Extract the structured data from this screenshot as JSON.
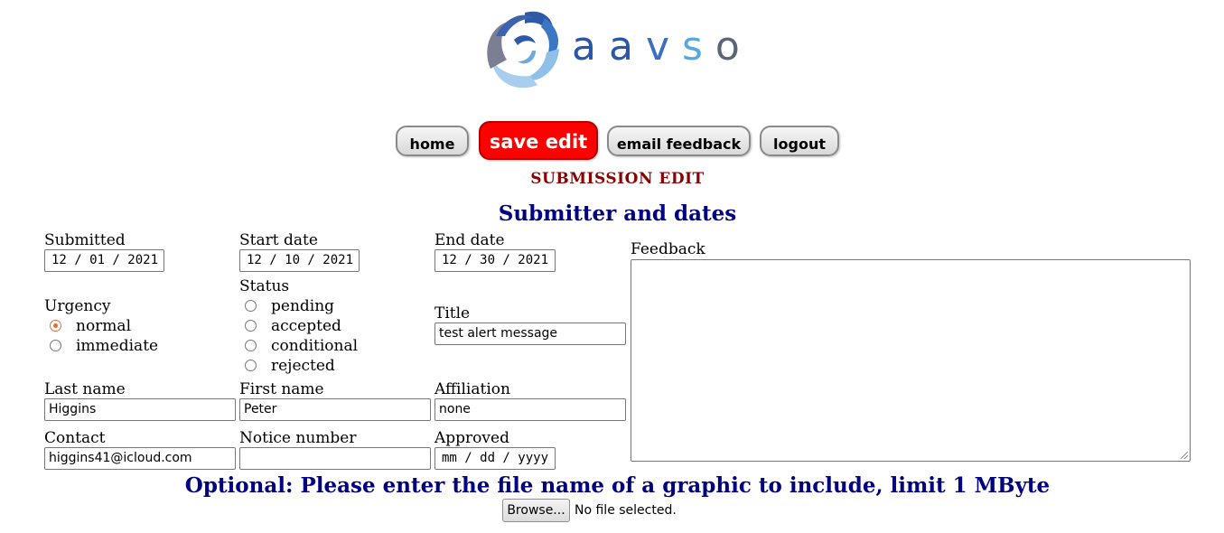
{
  "brand": {
    "name": "aavso",
    "letters": [
      "a",
      "a",
      "v",
      "s",
      "o"
    ],
    "letter_colors": [
      "#2b56a8",
      "#2b56a8",
      "#3a6fc0",
      "#59a7df",
      "#5a6577"
    ],
    "icon": "swirl-logo-icon"
  },
  "nav": {
    "home": "home",
    "save": "save edit",
    "email": "email feedback",
    "logout": "logout"
  },
  "colors": {
    "save_bg": "#ff0000",
    "heading_red": "#8b0000",
    "heading_blue": "#000080",
    "radio_checked": "#e86a3a"
  },
  "page_title": "SUBMISSION EDIT",
  "section_title": "Submitter and dates",
  "fields": {
    "submitted": {
      "label": "Submitted",
      "value": "12 / 01 / 2021"
    },
    "start_date": {
      "label": "Start date",
      "value": "12 / 10 / 2021"
    },
    "end_date": {
      "label": "End date",
      "value": "12 / 30 / 2021"
    },
    "feedback": {
      "label": "Feedback",
      "value": ""
    },
    "urgency": {
      "label": "Urgency",
      "options": [
        "normal",
        "immediate"
      ],
      "selected": "normal"
    },
    "status": {
      "label": "Status",
      "options": [
        "pending",
        "accepted",
        "conditional",
        "rejected"
      ],
      "selected": ""
    },
    "title": {
      "label": "Title",
      "value": "test alert message"
    },
    "last_name": {
      "label": "Last name",
      "value": "Higgins"
    },
    "first_name": {
      "label": "First name",
      "value": "Peter"
    },
    "affiliation": {
      "label": "Affiliation",
      "value": "none"
    },
    "contact": {
      "label": "Contact",
      "value": "higgins41@icloud.com"
    },
    "notice_number": {
      "label": "Notice number",
      "value": ""
    },
    "approved": {
      "label": "Approved",
      "value": "mm / dd / yyyy"
    }
  },
  "upload": {
    "prompt": "Optional: Please enter the file name of a graphic to include, limit 1 MByte",
    "button": "Browse...",
    "status": "No file selected."
  }
}
